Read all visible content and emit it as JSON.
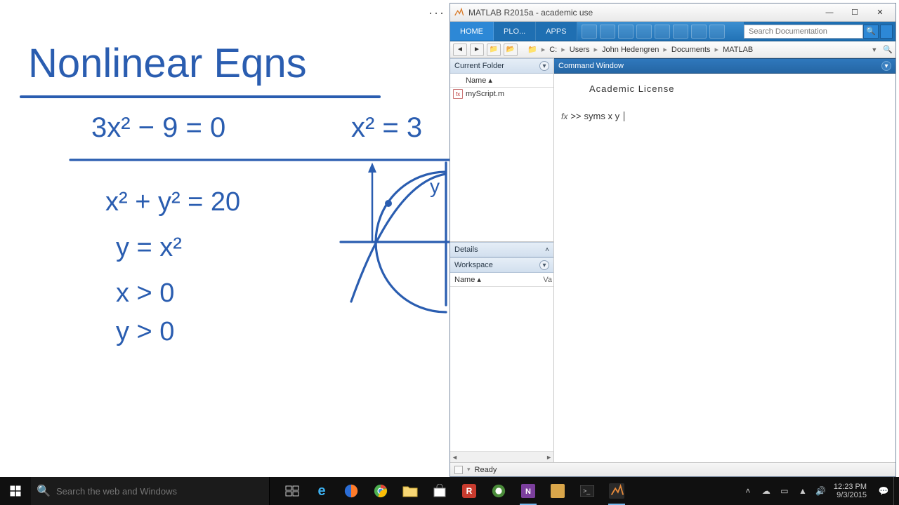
{
  "more_icon": "···",
  "handwriting": {
    "title": "Nonlinear Eqns",
    "eq1": "3x² − 9 = 0",
    "eq1b": "x² = 3",
    "eq2": "x² + y² = 20",
    "eq3": "y = x²",
    "eq4": "x > 0",
    "eq5": "y > 0",
    "axis_label": "y"
  },
  "matlab": {
    "title": "MATLAB R2015a - academic use",
    "tabs": {
      "home": "HOME",
      "plots": "PLO...",
      "apps": "APPS"
    },
    "search_placeholder": "Search Documentation",
    "address": {
      "drive": "C:",
      "p1": "Users",
      "p2": "John Hedengren",
      "p3": "Documents",
      "p4": "MATLAB"
    },
    "panels": {
      "current_folder": "Current Folder",
      "details": "Details",
      "workspace": "Workspace",
      "command_window": "Command Window"
    },
    "cf_header": "Name ▴",
    "cf_file": "myScript.m",
    "ws_header_name": "Name ▴",
    "ws_header_val": "Va",
    "command": {
      "license": "Academic License",
      "fx": "fx",
      "prompt": ">>",
      "input": "syms x y"
    },
    "status": "Ready"
  },
  "taskbar": {
    "search_placeholder": "Search the web and Windows",
    "clock_time": "12:23 PM",
    "clock_date": "9/3/2015"
  }
}
